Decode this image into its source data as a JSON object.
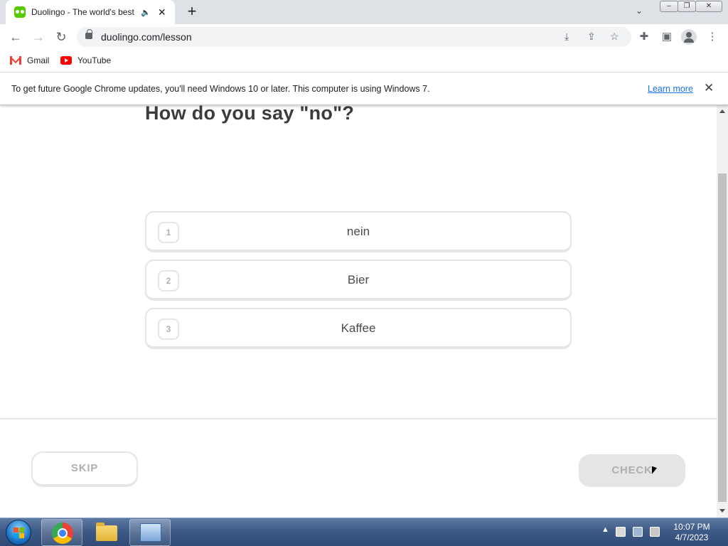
{
  "browser": {
    "tab_title": "Duolingo - The world's best",
    "url": "duolingo.com/lesson",
    "bookmarks": [
      {
        "label": "Gmail"
      },
      {
        "label": "YouTube"
      }
    ],
    "infobar": {
      "message": "To get future Google Chrome updates, you'll need Windows 10 or later. This computer is using Windows 7.",
      "link": "Learn more"
    }
  },
  "lesson": {
    "question": "How do you say \"no\"?",
    "choices": [
      {
        "number": "1",
        "text": "nein"
      },
      {
        "number": "2",
        "text": "Bier"
      },
      {
        "number": "3",
        "text": "Kaffee"
      }
    ],
    "skip_label": "SKIP",
    "check_label": "CHECK"
  },
  "taskbar": {
    "time": "10:07 PM",
    "date": "4/7/2023"
  },
  "colors": {
    "duolingo_green": "#58cc02",
    "border_gray": "#e5e5e5",
    "disabled_text": "#afafaf",
    "link_blue": "#1a73e8"
  },
  "icons": [
    "duolingo-favicon",
    "audio-icon",
    "close-icon",
    "plus-icon",
    "chevron-down-icon",
    "back-arrow-icon",
    "forward-arrow-icon",
    "reload-icon",
    "lock-icon",
    "install-icon",
    "share-icon",
    "star-icon",
    "extensions-icon",
    "side-panel-icon",
    "profile-icon",
    "menu-icon",
    "gmail-icon",
    "youtube-icon",
    "windows-start-icon",
    "chrome-icon",
    "folder-icon",
    "control-panel-icon"
  ]
}
